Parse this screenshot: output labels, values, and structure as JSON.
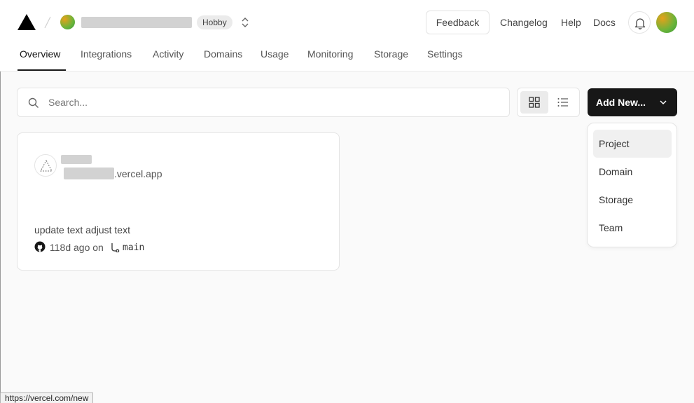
{
  "header": {
    "plan_badge": "Hobby",
    "feedback_label": "Feedback",
    "links": [
      "Changelog",
      "Help",
      "Docs"
    ]
  },
  "tabs": [
    "Overview",
    "Integrations",
    "Activity",
    "Domains",
    "Usage",
    "Monitoring",
    "Storage",
    "Settings"
  ],
  "toolbar": {
    "search_placeholder": "Search...",
    "add_new_label": "Add New..."
  },
  "add_new_menu": [
    "Project",
    "Domain",
    "Storage",
    "Team"
  ],
  "project": {
    "domain_suffix": ".vercel.app",
    "commit_message": "update text adjust text",
    "commit_age": "118d ago on",
    "branch": "main"
  },
  "status_bar": {
    "url": "https://vercel.com/new"
  },
  "colors": {
    "primary": "#171717",
    "background": "#fafafa",
    "border": "#e4e4e4"
  }
}
